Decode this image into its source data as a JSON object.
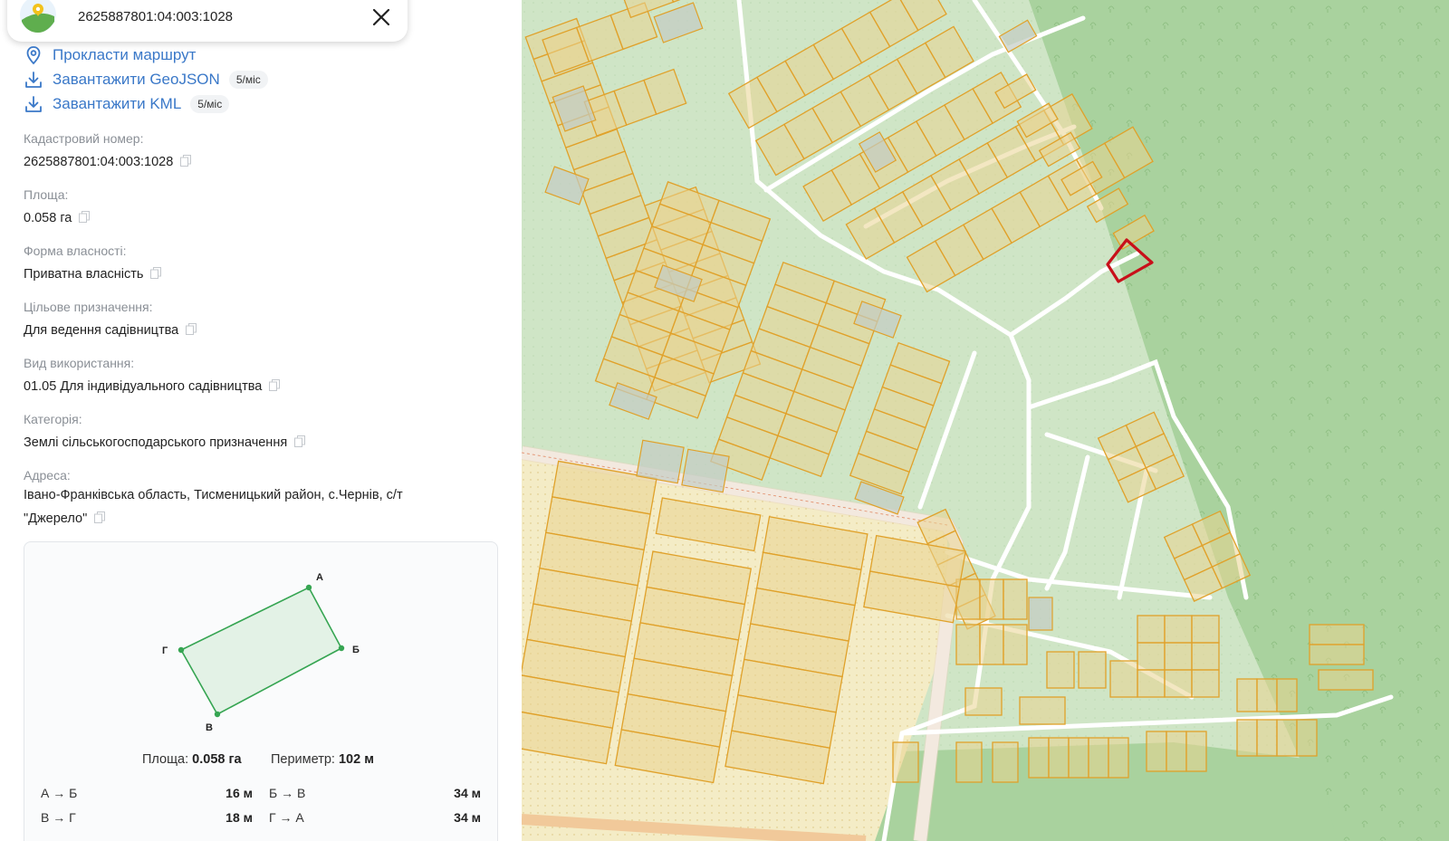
{
  "search": {
    "query": "2625887801:04:003:1028"
  },
  "actions": [
    {
      "label": "Прокласти маршрут",
      "icon": "location-pin-icon"
    },
    {
      "label": "Завантажити GeoJSON",
      "icon": "download-icon",
      "badge": "5/міс"
    },
    {
      "label": "Завантажити KML",
      "icon": "download-icon",
      "badge": "5/міс"
    }
  ],
  "fields": [
    {
      "label": "Кадастровий номер:",
      "value": "2625887801:04:003:1028"
    },
    {
      "label": "Площа:",
      "value": "0.058 га"
    },
    {
      "label": "Форма власності:",
      "value": "Приватна власність"
    },
    {
      "label": "Цільове призначення:",
      "value": "Для ведення садівництва"
    },
    {
      "label": "Вид використання:",
      "value": "01.05 Для індивідуального садівництва"
    },
    {
      "label": "Категорія:",
      "value": "Землі сільськогосподарського призначення"
    },
    {
      "label": "Адреса:",
      "value_line1": "Івано-Франківська область, Тисменицький район, с.Чернів, с/т",
      "value_line2": "\"Джерело\""
    }
  ],
  "shape": {
    "vertices": [
      {
        "label": "А"
      },
      {
        "label": "Б"
      },
      {
        "label": "В"
      },
      {
        "label": "Г"
      }
    ],
    "area_label": "Площа:",
    "area_value": "0.058 га",
    "perimeter_label": "Периметр:",
    "perimeter_value": "102 м",
    "sides": [
      {
        "name": "А → Б",
        "length": "16 м"
      },
      {
        "name": "Б → В",
        "length": "34 м"
      },
      {
        "name": "В → Г",
        "length": "18 м"
      },
      {
        "name": "Г → А",
        "length": "34 м"
      }
    ]
  },
  "colors": {
    "link": "#3a78c8",
    "map_green": "#cfe5c6",
    "forest": "#a9d29e",
    "parcel_fill": "#e9d48f",
    "parcel_stroke": "#e0a12a",
    "selected": "#c8101a",
    "shape_green": "#36a552"
  }
}
